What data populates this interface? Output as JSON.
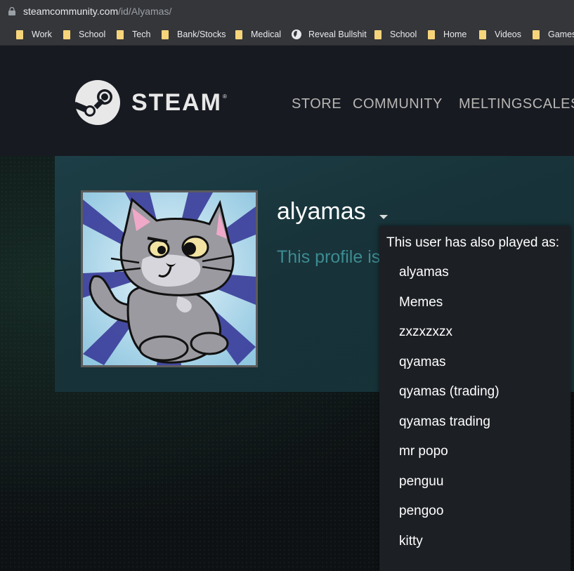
{
  "browser": {
    "url_domain": "steamcommunity.com",
    "url_path": "/id/Alyamas/",
    "bookmarks": [
      {
        "label": "Work",
        "icon": "folder-icon"
      },
      {
        "label": "School",
        "icon": "folder-icon"
      },
      {
        "label": "Tech",
        "icon": "folder-icon"
      },
      {
        "label": "Bank/Stocks",
        "icon": "folder-icon"
      },
      {
        "label": "Medical",
        "icon": "folder-icon"
      },
      {
        "label": "Reveal Bullshit",
        "icon": "globe-icon"
      },
      {
        "label": "School",
        "icon": "folder-icon"
      },
      {
        "label": "Home",
        "icon": "folder-icon"
      },
      {
        "label": "Videos",
        "icon": "folder-icon"
      },
      {
        "label": "Games",
        "icon": "folder-icon"
      }
    ]
  },
  "steam": {
    "wordmark": "STEAM",
    "registered": "®",
    "nav": [
      "STORE",
      "COMMUNITY",
      "MELTINGSCALES"
    ]
  },
  "profile": {
    "persona_name": "alyamas",
    "private_notice": "This profile is private."
  },
  "alias_dropdown": {
    "title": "This user has also played as:",
    "aliases": [
      "alyamas",
      "Memes",
      "zxzxzxzx",
      "qyamas",
      "qyamas (trading)",
      "qyamas trading",
      "mr popo",
      "penguu",
      "pengoo",
      "kitty"
    ]
  },
  "colors": {
    "steam_header_bg": "#171a21",
    "profile_header_bg": "#173238",
    "private_text": "#3c8c92",
    "dropdown_bg": "#1c1f24",
    "bookmark_folder": "#f6d47a"
  }
}
